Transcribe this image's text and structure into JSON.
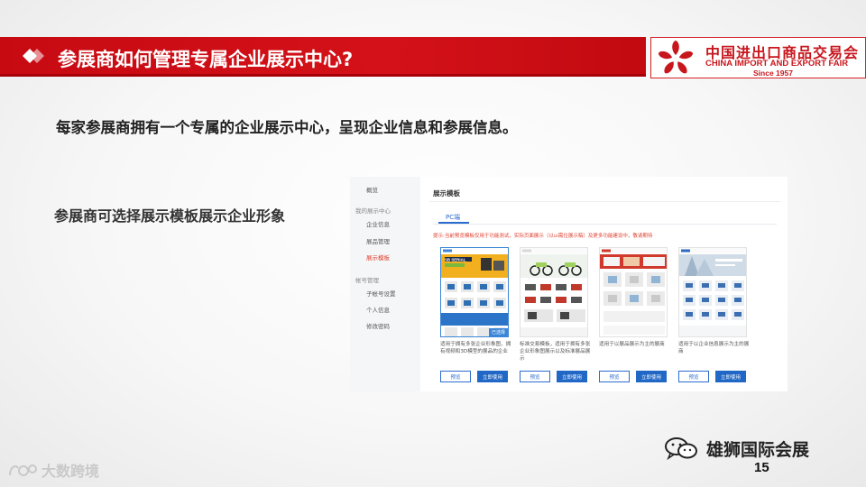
{
  "slide": {
    "title": "参展商如何管理专属企业展示中心?",
    "lead": "每家参展商拥有一个专属的企业展示中心，呈现企业信息和参展信息。",
    "subheading": "参展商可选择展示模板展示企业形象",
    "page_number": "15"
  },
  "logo": {
    "chinese": "中国进出口商品交易会",
    "english": "CHINA IMPORT AND EXPORT FAIR",
    "since": "Since 1957"
  },
  "screenshot": {
    "sidebar": {
      "overview": "概览",
      "group_showcase": "我的展示中心",
      "company_info": "企业信息",
      "product_mgmt": "展品管理",
      "template": "展示模板",
      "group_account": "帐号管理",
      "sub_accounts": "子帐号设置",
      "personal_info": "个人信息",
      "change_password": "修改密码"
    },
    "header": "展示模板",
    "tab_pc": "PC端",
    "notice": "提示:当前预览模板仅用于功能测试，实际页面展示（以ui需位展示稿）及更多功能建设中，敬请期待",
    "selected_badge": "已选择",
    "cards": [
      {
        "desc": "适用于拥有多张企业形象图，拥有视频和3D模型的展品的企业",
        "preview": "预览",
        "use": "立即使用"
      },
      {
        "desc": "标准交易模板，适用于拥有多张企业形象图展示以及标准展品展示",
        "preview": "预览",
        "use": "立即使用"
      },
      {
        "desc": "适用于以展品展示为主的展商",
        "preview": "预览",
        "use": "立即使用"
      },
      {
        "desc": "适用于以企业信息展示为主的展商",
        "preview": "预览",
        "use": "立即使用"
      }
    ],
    "card1_banner": "SB SERIAL"
  },
  "watermarks": {
    "left": "大数跨境",
    "right": "雄狮国际会展"
  },
  "colors": {
    "title_red": "#d41119",
    "accent_blue": "#2168c6",
    "notice_red": "#e0412f"
  }
}
